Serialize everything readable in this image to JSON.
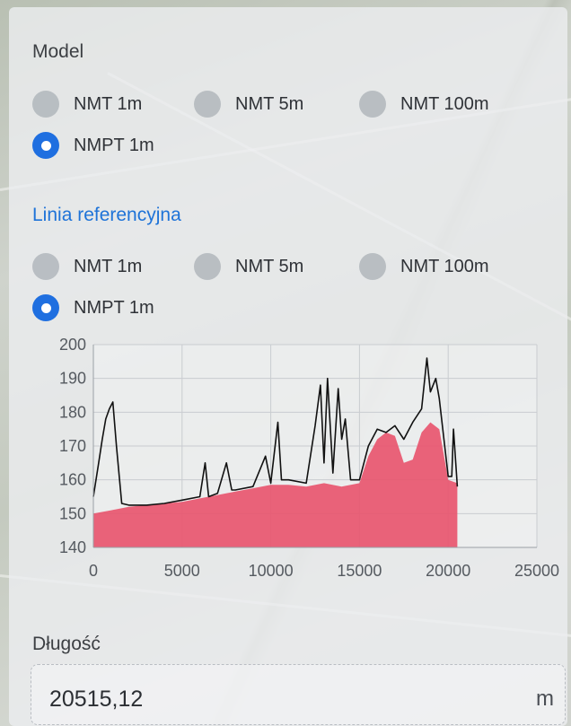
{
  "model": {
    "title": "Model",
    "options": [
      {
        "label": "NMT 1m",
        "checked": false
      },
      {
        "label": "NMT 5m",
        "checked": false
      },
      {
        "label": "NMT 100m",
        "checked": false
      },
      {
        "label": "NMPT 1m",
        "checked": true
      }
    ]
  },
  "reference": {
    "title": "Linia referencyjna",
    "options": [
      {
        "label": "NMT 1m",
        "checked": false
      },
      {
        "label": "NMT 5m",
        "checked": false
      },
      {
        "label": "NMT 100m",
        "checked": false
      },
      {
        "label": "NMPT 1m",
        "checked": true
      }
    ]
  },
  "chart_data": {
    "type": "area",
    "x_ticks": [
      "0",
      "5000",
      "10000",
      "15000",
      "20000",
      "25000"
    ],
    "y_ticks": [
      "140",
      "150",
      "160",
      "170",
      "180",
      "190",
      "200"
    ],
    "xlim": [
      0,
      25000
    ],
    "ylim": [
      140,
      200
    ],
    "grid": true,
    "series": [
      {
        "kind": "reference-area",
        "color": "#e8566f",
        "x": [
          0,
          1000,
          2000,
          3000,
          4000,
          5000,
          6000,
          7000,
          8000,
          9000,
          10000,
          11000,
          12000,
          13000,
          14000,
          15000,
          15500,
          16000,
          16500,
          17000,
          17500,
          18000,
          18500,
          19000,
          19500,
          20000,
          20515
        ],
        "y": [
          150,
          151,
          152,
          152.5,
          153,
          153.5,
          154.5,
          155.5,
          156.5,
          157.5,
          158.5,
          158.5,
          158,
          159,
          158,
          159,
          167,
          172,
          174,
          173,
          165,
          166,
          174,
          177,
          175,
          160,
          159
        ]
      },
      {
        "kind": "model-line",
        "color": "#111111",
        "x": [
          0,
          300,
          500,
          700,
          900,
          1100,
          1300,
          1600,
          2000,
          3000,
          4000,
          5000,
          6000,
          6300,
          6500,
          7000,
          7500,
          7800,
          8000,
          9000,
          9700,
          10000,
          10400,
          10600,
          11000,
          12000,
          12500,
          12800,
          13000,
          13200,
          13500,
          13800,
          14000,
          14200,
          14500,
          15000,
          15500,
          16000,
          16500,
          17000,
          17500,
          18000,
          18500,
          18800,
          19000,
          19300,
          19500,
          20000,
          20200,
          20300,
          20515
        ],
        "y": [
          155,
          165,
          172,
          178,
          181,
          183,
          170,
          153,
          152.5,
          152.5,
          153,
          154,
          155,
          165,
          155,
          156,
          165,
          157,
          157,
          158,
          167,
          159,
          177,
          160,
          160,
          159,
          176,
          188,
          165,
          190,
          162,
          187,
          172,
          178,
          160,
          160,
          170,
          175,
          174,
          176,
          172,
          177,
          181,
          196,
          186,
          190,
          184,
          161,
          161,
          175,
          158
        ]
      }
    ]
  },
  "length": {
    "label": "Długość",
    "value": "20515,12",
    "unit": "m"
  }
}
